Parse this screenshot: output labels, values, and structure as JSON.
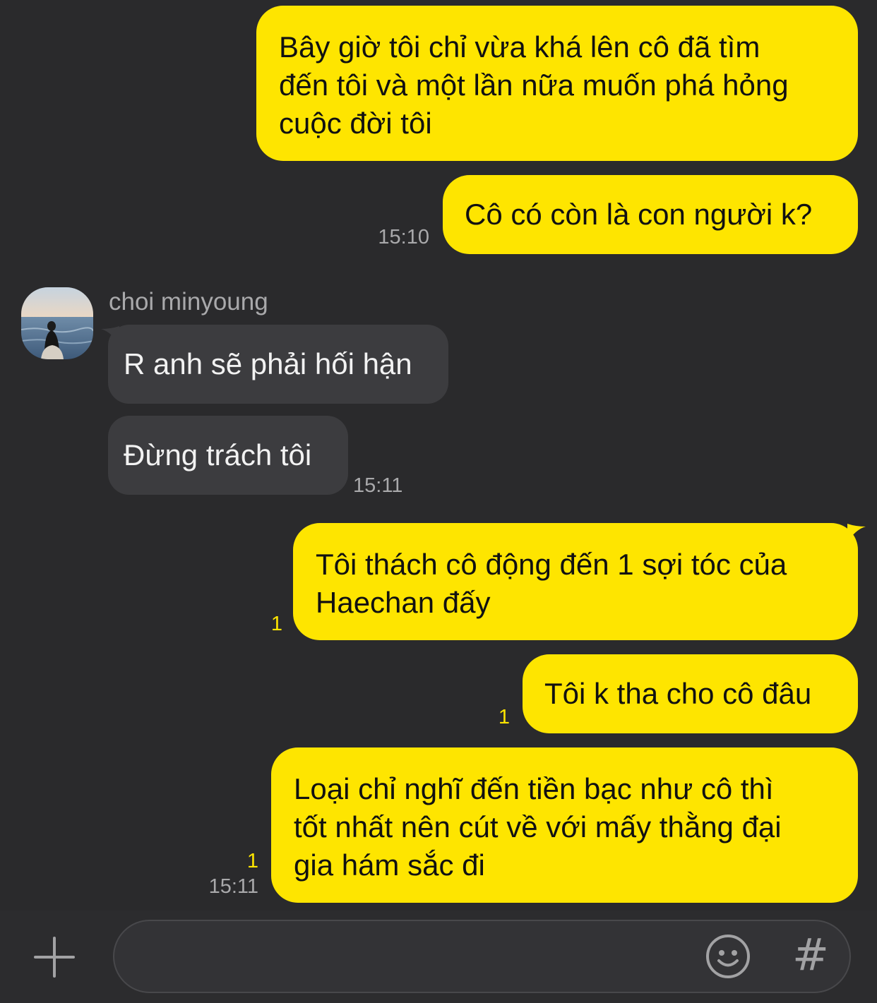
{
  "conversation": {
    "contact_name": "choi minyoung",
    "messages": [
      {
        "direction": "out",
        "text": "Bây giờ tôi chỉ vừa khá lên cô đã tìm\nđến tôi và một lần nữa muốn phá hỏng\ncuộc đời tôi",
        "time": "",
        "unread": ""
      },
      {
        "direction": "out",
        "text": "Cô có còn là con người k?",
        "time": "15:10",
        "unread": ""
      },
      {
        "direction": "in",
        "text": "R anh sẽ phải hối hận",
        "time": "",
        "unread": ""
      },
      {
        "direction": "in",
        "text": "Đừng trách tôi",
        "time": "15:11",
        "unread": ""
      },
      {
        "direction": "out",
        "text": "Tôi thách cô động đến 1 sợi tóc của\nHaechan đấy",
        "time": "",
        "unread": "1"
      },
      {
        "direction": "out",
        "text": "Tôi k tha cho cô đâu",
        "time": "",
        "unread": "1"
      },
      {
        "direction": "out",
        "text": "Loại chỉ nghĩ đến tiền bạc như cô thì\ntốt nhất nên cút về với mấy thằng đại\ngia hám sắc đi",
        "time": "15:11",
        "unread": "1"
      }
    ]
  },
  "composer": {
    "input_value": "",
    "add_icon": "plus-icon",
    "emoticon_icon": "emoticon-icon",
    "hashtag_icon": "hash-icon",
    "hashtag_glyph": "#"
  },
  "colors": {
    "background": "#2a2a2c",
    "outgoing_bubble": "#fee500",
    "incoming_bubble": "#3c3c3f",
    "unread_count": "#fee500",
    "timestamp": "#a9a9ab"
  }
}
